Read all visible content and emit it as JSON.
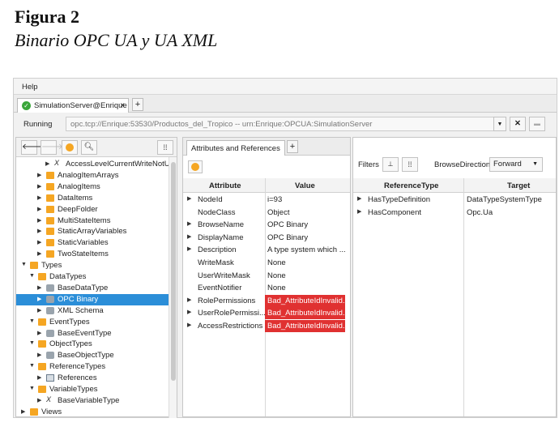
{
  "figure": {
    "title": "Figura 2",
    "subtitle": "Binario OPC UA y UA XML"
  },
  "menu": {
    "help": "Help"
  },
  "tab": {
    "label": "SimulationServer@Enrique",
    "close": "×",
    "add": "+"
  },
  "connection": {
    "status": "Running",
    "url": "opc.tcp://Enrique:53530/Productos_del_Tropico -- urn:Enrique:OPCUA:SimulationServer",
    "dropdown_icon": "chevron-down-icon",
    "disconnect_icon": "close-icon",
    "lock_icon": "lock-icon"
  },
  "left_toolbar": {
    "back_icon": "arrow-left-icon",
    "forward_icon": "arrow-right-icon",
    "refresh_icon": "refresh-icon",
    "search_icon": "search-icon",
    "grid_icon": "grid-icon"
  },
  "tree": [
    {
      "label": "AccessLevelCurrentWriteNotUser",
      "depth": 3,
      "icon": "variable-type-icon",
      "arrow": "collapsed"
    },
    {
      "label": "AnalogItemArrays",
      "depth": 2,
      "icon": "folder-icon",
      "arrow": "collapsed"
    },
    {
      "label": "AnalogItems",
      "depth": 2,
      "icon": "folder-icon",
      "arrow": "collapsed"
    },
    {
      "label": "DataItems",
      "depth": 2,
      "icon": "folder-icon",
      "arrow": "collapsed"
    },
    {
      "label": "DeepFolder",
      "depth": 2,
      "icon": "folder-icon",
      "arrow": "collapsed"
    },
    {
      "label": "MultiStateItems",
      "depth": 2,
      "icon": "folder-icon",
      "arrow": "collapsed"
    },
    {
      "label": "StaticArrayVariables",
      "depth": 2,
      "icon": "folder-icon",
      "arrow": "collapsed"
    },
    {
      "label": "StaticVariables",
      "depth": 2,
      "icon": "folder-icon",
      "arrow": "collapsed"
    },
    {
      "label": "TwoStateItems",
      "depth": 2,
      "icon": "folder-icon",
      "arrow": "collapsed"
    },
    {
      "label": "Types",
      "depth": 0,
      "icon": "folder-icon",
      "arrow": "expanded"
    },
    {
      "label": "DataTypes",
      "depth": 1,
      "icon": "folder-icon",
      "arrow": "expanded"
    },
    {
      "label": "BaseDataType",
      "depth": 2,
      "icon": "object-icon",
      "arrow": "collapsed"
    },
    {
      "label": "OPC Binary",
      "depth": 2,
      "icon": "object-icon",
      "arrow": "collapsed",
      "selected": true
    },
    {
      "label": "XML Schema",
      "depth": 2,
      "icon": "object-icon",
      "arrow": "collapsed"
    },
    {
      "label": "EventTypes",
      "depth": 1,
      "icon": "folder-icon",
      "arrow": "expanded"
    },
    {
      "label": "BaseEventType",
      "depth": 2,
      "icon": "object-icon",
      "arrow": "collapsed"
    },
    {
      "label": "ObjectTypes",
      "depth": 1,
      "icon": "folder-icon",
      "arrow": "expanded"
    },
    {
      "label": "BaseObjectType",
      "depth": 2,
      "icon": "object-icon",
      "arrow": "collapsed"
    },
    {
      "label": "ReferenceTypes",
      "depth": 1,
      "icon": "folder-icon",
      "arrow": "expanded"
    },
    {
      "label": "References",
      "depth": 2,
      "icon": "reference-icon",
      "arrow": "collapsed"
    },
    {
      "label": "VariableTypes",
      "depth": 1,
      "icon": "folder-icon",
      "arrow": "expanded"
    },
    {
      "label": "BaseVariableType",
      "depth": 2,
      "icon": "variable-type-icon",
      "arrow": "collapsed"
    },
    {
      "label": "Views",
      "depth": 0,
      "icon": "folder-icon",
      "arrow": "collapsed"
    }
  ],
  "attributes_panel": {
    "tab_label": "Attributes and References",
    "tab_add": "+",
    "col_attribute": "Attribute",
    "col_value": "Value",
    "rows": [
      {
        "attribute": "NodeId",
        "value": "i=93",
        "expandable": true,
        "bad": false
      },
      {
        "attribute": "NodeClass",
        "value": "Object",
        "expandable": false,
        "bad": false
      },
      {
        "attribute": "BrowseName",
        "value": "OPC Binary",
        "expandable": true,
        "bad": false
      },
      {
        "attribute": "DisplayName",
        "value": "OPC Binary",
        "expandable": true,
        "bad": false
      },
      {
        "attribute": "Description",
        "value": "A type system which ...",
        "expandable": true,
        "bad": false
      },
      {
        "attribute": "WriteMask",
        "value": "None",
        "expandable": false,
        "bad": false
      },
      {
        "attribute": "UserWriteMask",
        "value": "None",
        "expandable": false,
        "bad": false
      },
      {
        "attribute": "EventNotifier",
        "value": "None",
        "expandable": false,
        "bad": false
      },
      {
        "attribute": "RolePermissions",
        "value": "Bad_AttributeIdInvalid...",
        "expandable": true,
        "bad": true
      },
      {
        "attribute": "UserRolePermissi...",
        "value": "Bad_AttributeIdInvalid...",
        "expandable": true,
        "bad": true
      },
      {
        "attribute": "AccessRestrictions",
        "value": "Bad_AttributeIdInvalid...",
        "expandable": true,
        "bad": true
      }
    ],
    "bad_color": "#e03131"
  },
  "references_panel": {
    "filters_label": "Filters",
    "browse_direction_label": "BrowseDirection",
    "browse_direction_value": "Forward",
    "col_reference_type": "ReferenceType",
    "col_target": "Target",
    "rows": [
      {
        "reference_type": "HasTypeDefinition",
        "target": "DataTypeSystemType"
      },
      {
        "reference_type": "HasComponent",
        "target": "Opc.Ua"
      }
    ]
  },
  "colors": {
    "selection": "#2b8ed8",
    "folder": "#f5a623",
    "ok": "#3aa63a"
  }
}
